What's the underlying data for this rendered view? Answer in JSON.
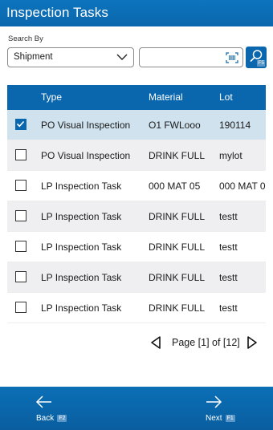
{
  "app": {
    "title": "Inspection Tasks"
  },
  "search": {
    "label": "Search By",
    "selected": "Shipment",
    "input_value": "",
    "input_placeholder": "",
    "button_key": "F5"
  },
  "table": {
    "headers": {
      "type": "Type",
      "material": "Material",
      "lot": "Lot"
    },
    "rows": [
      {
        "checked": true,
        "type": "PO Visual Inspection",
        "material": "O1 FWLooo",
        "lot": "190114"
      },
      {
        "checked": false,
        "type": "PO Visual Inspection",
        "material": "DRINK FULL",
        "lot": "mylot"
      },
      {
        "checked": false,
        "type": "LP Inspection Task",
        "material": "000 MAT 05",
        "lot": "000 MAT 0"
      },
      {
        "checked": false,
        "type": "LP Inspection Task",
        "material": "DRINK FULL",
        "lot": "testt"
      },
      {
        "checked": false,
        "type": "LP Inspection Task",
        "material": "DRINK FULL",
        "lot": "testt"
      },
      {
        "checked": false,
        "type": "LP Inspection Task",
        "material": "DRINK FULL",
        "lot": "testt"
      },
      {
        "checked": false,
        "type": "LP Inspection Task",
        "material": "DRINK FULL",
        "lot": "testt"
      }
    ]
  },
  "pager": {
    "text": "Page [1] of [12]"
  },
  "footer": {
    "back_label": "Back",
    "back_key": "F2",
    "next_label": "Next",
    "next_key": "F1"
  },
  "colors": {
    "accent": "#0a67ad",
    "selected_row": "#cfe2ee",
    "alt_row": "#efeff2"
  },
  "icons": {
    "dropdown": "chevron-down-icon",
    "scan": "barcode-scan-icon",
    "search": "search-icon",
    "check": "check-icon",
    "prev": "triangle-left-icon",
    "next": "triangle-right-icon",
    "back": "arrow-left-icon",
    "forward": "arrow-right-icon"
  }
}
